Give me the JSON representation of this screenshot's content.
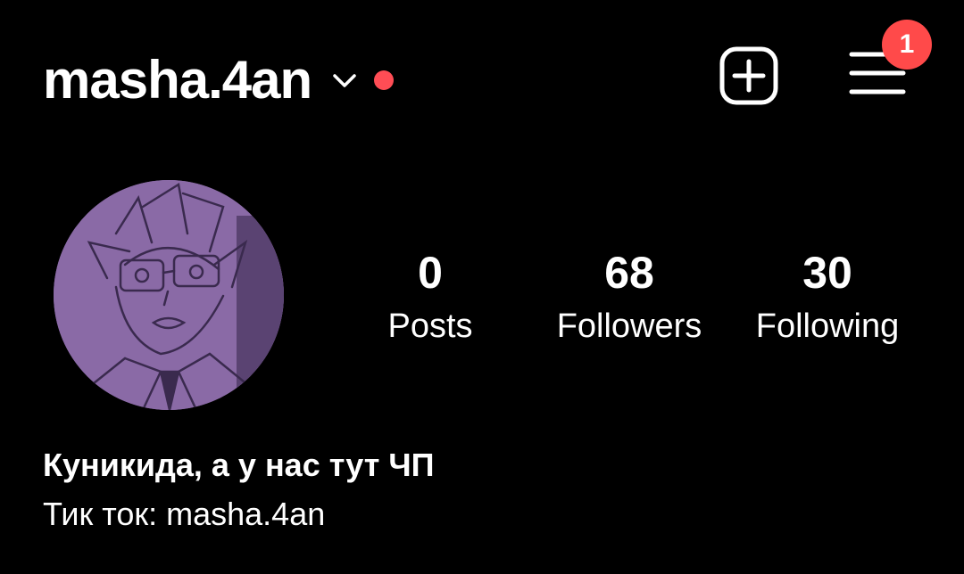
{
  "header": {
    "username": "masha.4an",
    "account_switcher_icon": "chevron-down-icon",
    "live_indicator_color": "#ff4d55",
    "new_post_icon": "plus-square-icon",
    "menu_icon": "hamburger-menu-icon",
    "menu_badge_count": "1",
    "badge_color": "#ff4a4a"
  },
  "profile": {
    "avatar_icon": "avatar-anime-character",
    "avatar_tint": "#8a6aa6",
    "stats": [
      {
        "value": "0",
        "label": "Posts"
      },
      {
        "value": "68",
        "label": "Followers"
      },
      {
        "value": "30",
        "label": "Following"
      }
    ]
  },
  "bio": {
    "name": "Куникида, а у нас тут ЧП",
    "text": "Тик ток: masha.4an"
  },
  "theme": {
    "background": "#000000",
    "foreground": "#ffffff"
  }
}
